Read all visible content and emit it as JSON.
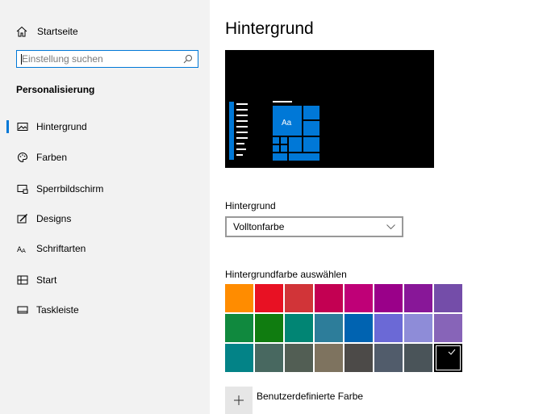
{
  "sidebar": {
    "home_label": "Startseite",
    "search_placeholder": "Einstellung suchen",
    "section_title": "Personalisierung",
    "items": [
      {
        "label": "Hintergrund",
        "icon": "picture-icon",
        "active": true
      },
      {
        "label": "Farben",
        "icon": "palette-icon",
        "active": false
      },
      {
        "label": "Sperrbildschirm",
        "icon": "lock-screen-icon",
        "active": false
      },
      {
        "label": "Designs",
        "icon": "brush-icon",
        "active": false
      },
      {
        "label": "Schriftarten",
        "icon": "font-icon",
        "active": false
      },
      {
        "label": "Start",
        "icon": "start-icon",
        "active": false
      },
      {
        "label": "Taskleiste",
        "icon": "taskbar-icon",
        "active": false
      }
    ]
  },
  "main": {
    "title": "Hintergrund",
    "preview_tile_text": "Aa",
    "background_label": "Hintergrund",
    "background_value": "Volltonfarbe",
    "color_label": "Hintergrundfarbe auswählen",
    "custom_color_label": "Benutzerdefinierte Farbe",
    "custom_color_button": "+"
  },
  "colors": {
    "accent": "#0078d7",
    "swatches": [
      [
        "#ff8c00",
        "#e81123",
        "#d13438",
        "#c30052",
        "#bf0077",
        "#9a0089",
        "#881798",
        "#744da9"
      ],
      [
        "#10893e",
        "#107c10",
        "#018574",
        "#2d7d9a",
        "#0063b1",
        "#6b69d6",
        "#8e8cd8",
        "#8764b8"
      ],
      [
        "#038387",
        "#486860",
        "#525e54",
        "#7e735f",
        "#4c4a48",
        "#515c6b",
        "#4a5459",
        "#000000"
      ]
    ],
    "selected_swatch": "#000000"
  }
}
